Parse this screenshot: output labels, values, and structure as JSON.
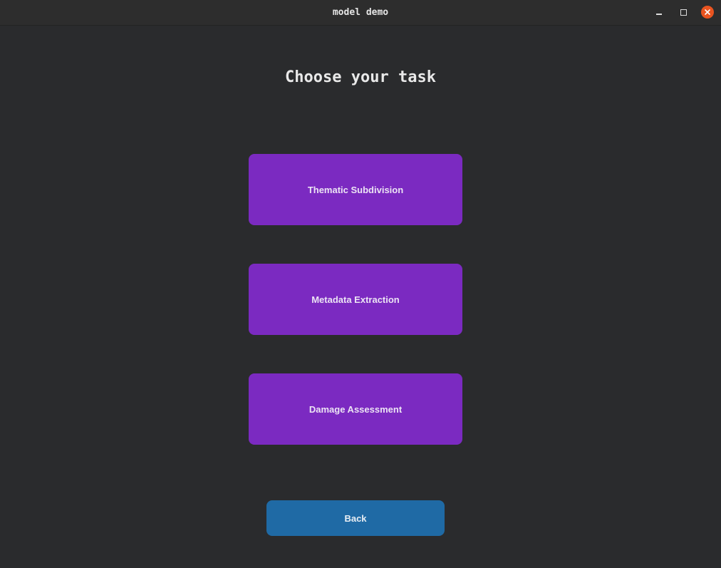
{
  "window": {
    "title": "model demo",
    "controls": {
      "minimize_icon": "minimize-icon",
      "maximize_icon": "maximize-icon",
      "close_icon": "close-icon"
    }
  },
  "main": {
    "heading": "Choose your task",
    "tasks": [
      {
        "label": "Thematic Subdivision"
      },
      {
        "label": "Metadata Extraction"
      },
      {
        "label": "Damage Assessment"
      }
    ],
    "back_label": "Back"
  },
  "colors": {
    "background": "#2a2b2d",
    "task_button": "#7b2ac1",
    "back_button": "#1f6aa5",
    "close_button": "#e95420"
  }
}
